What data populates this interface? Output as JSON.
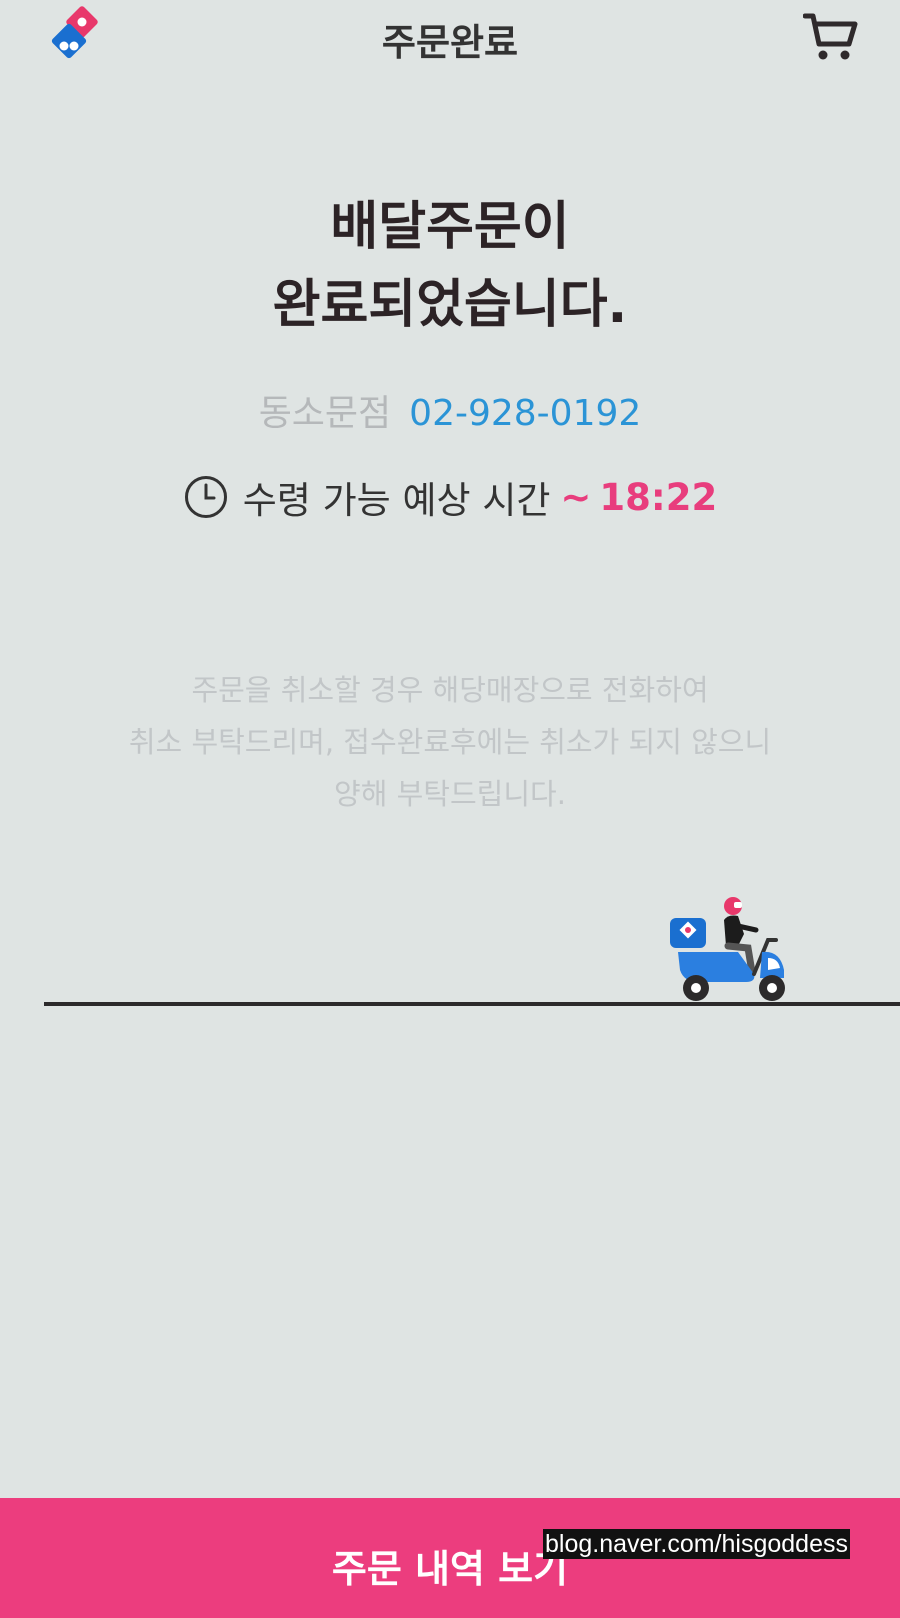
{
  "header": {
    "title": "주문완료",
    "logo_icon": "domino-logo-icon",
    "cart_icon": "cart-icon"
  },
  "headline": {
    "line1": "배달주문이",
    "line2": "완료되었습니다."
  },
  "store": {
    "name": "동소문점",
    "phone": "02-928-0192"
  },
  "pickup": {
    "label": "수령 가능 예상 시간",
    "prefix": "~",
    "time": "18:22",
    "clock_icon": "clock-icon"
  },
  "notice": {
    "line1": "주문을 취소할 경우 해당매장으로 전화하여",
    "line2": "취소 부탁드리며, 접수완료후에는 취소가 되지 않으니",
    "line3": "양해 부탁드립니다."
  },
  "footer": {
    "button_label": "주문 내역 보기"
  },
  "watermark": "blog.naver.com/hisgoddess",
  "colors": {
    "background": "#dfe4e3",
    "accent_pink": "#ec3d7e",
    "phone_blue": "#2b94d6",
    "logo_blue": "#1a6fd0",
    "logo_red": "#e8386b"
  }
}
